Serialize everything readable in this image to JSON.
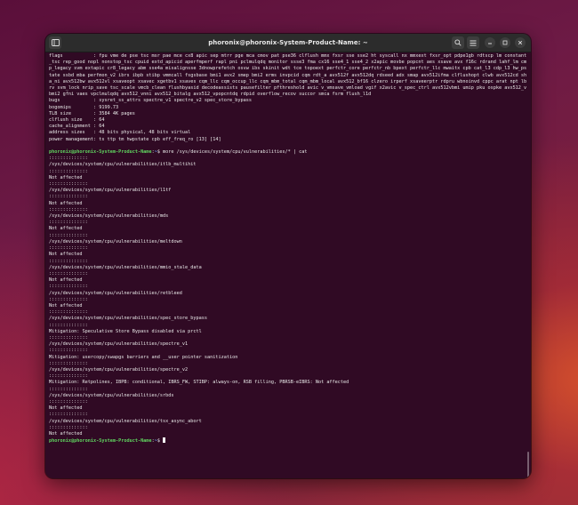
{
  "window": {
    "title": "phoronix@phoronix-System-Product-Name: ~"
  },
  "titlebar": {
    "new_tab_icon": "terminal-tab-icon",
    "search_icon": "search-icon",
    "menu_icon": "hamburger-menu-icon",
    "minimize_icon": "minimize-icon",
    "maximize_icon": "maximize-icon",
    "close_icon": "close-icon"
  },
  "terminal": {
    "lines": [
      {
        "text": "flags           : fpu vme de pse tsc msr pae mce cx8 apic sep mtrr pge mca cmov pat pse36 clflush mmx fxsr sse sse2 ht syscall nx mmxext fxsr_opt pdpe1gb rdtscp lm constant_tsc rep_good nopl nonstop_tsc cpuid extd_apicid aperfmperf rapl pni pclmulqdq monitor ssse3 fma cx16 sse4_1 sse4_2 x2apic movbe popcnt aes xsave avx f16c rdrand lahf_lm cmp_legacy svm extapic cr8_legacy abm sse4a misalignsse 3dnowprefetch osvw ibs skinit wdt tce topoext perfctr_core perfctr_nb bpext perfctr_llc mwaitx cpb cat_l3 cdp_l3 hw_pstate ssbd mba perfmon_v2 ibrs ibpb stibp vmmcall fsgsbase bmi1 avx2 smep bmi2 erms invpcid cqm rdt_a avx512f avx512dq rdseed adx smap avx512ifma clflushopt clwb avx512cd sha_ni avx512bw avx512vl xsaveopt xsavec xgetbv1 xsaves cqm_llc cqm_occup_llc cqm_mbm_total cqm_mbm_local avx512_bf16 clzero irperf xsaveerptr rdpru wbnoinvd cppc arat npt lbrv svm_lock nrip_save tsc_scale vmcb_clean flushbyasid decodeassists pausefilter pfthreshold avic v_vmsave_vmload vgif x2avic v_spec_ctrl avx512vbmi umip pku ospke avx512_vbmi2 gfni vaes vpclmulqdq avx512_vnni avx512_bitalg avx512_vpopcntdq rdpid overflow_recov succor smca fsrm flush_l1d"
      },
      {
        "text": "bugs            : sysret_ss_attrs spectre_v1 spectre_v2 spec_store_bypass"
      },
      {
        "text": "bogomips        : 9199.73"
      },
      {
        "text": "TLB size        : 3584 4K pages"
      },
      {
        "text": "clflush size    : 64"
      },
      {
        "text": "cache_alignment : 64"
      },
      {
        "text": "address sizes   : 48 bits physical, 48 bits virtual"
      },
      {
        "text": "power management: ts ttp tm hwpstate cpb eff_freq_ro [13] [14]"
      },
      {
        "text": ""
      },
      {
        "prompt": true,
        "user": "phoronix@phoronix-System-Product-Name",
        "path": "~",
        "cmd": "$ more /sys/devices/system/cpu/vulnerabilities/* | cat"
      },
      {
        "text": "::::::::::::::"
      },
      {
        "text": "/sys/devices/system/cpu/vulnerabilities/itlb_multihit"
      },
      {
        "text": "::::::::::::::"
      },
      {
        "text": "Not affected"
      },
      {
        "text": "::::::::::::::"
      },
      {
        "text": "/sys/devices/system/cpu/vulnerabilities/l1tf"
      },
      {
        "text": "::::::::::::::"
      },
      {
        "text": "Not affected"
      },
      {
        "text": "::::::::::::::"
      },
      {
        "text": "/sys/devices/system/cpu/vulnerabilities/mds"
      },
      {
        "text": "::::::::::::::"
      },
      {
        "text": "Not affected"
      },
      {
        "text": "::::::::::::::"
      },
      {
        "text": "/sys/devices/system/cpu/vulnerabilities/meltdown"
      },
      {
        "text": "::::::::::::::"
      },
      {
        "text": "Not affected"
      },
      {
        "text": "::::::::::::::"
      },
      {
        "text": "/sys/devices/system/cpu/vulnerabilities/mmio_stale_data"
      },
      {
        "text": "::::::::::::::"
      },
      {
        "text": "Not affected"
      },
      {
        "text": "::::::::::::::"
      },
      {
        "text": "/sys/devices/system/cpu/vulnerabilities/retbleed"
      },
      {
        "text": "::::::::::::::"
      },
      {
        "text": "Not affected"
      },
      {
        "text": "::::::::::::::"
      },
      {
        "text": "/sys/devices/system/cpu/vulnerabilities/spec_store_bypass"
      },
      {
        "text": "::::::::::::::"
      },
      {
        "text": "Mitigation: Speculative Store Bypass disabled via prctl"
      },
      {
        "text": "::::::::::::::"
      },
      {
        "text": "/sys/devices/system/cpu/vulnerabilities/spectre_v1"
      },
      {
        "text": "::::::::::::::"
      },
      {
        "text": "Mitigation: usercopy/swapgs barriers and __user pointer sanitization"
      },
      {
        "text": "::::::::::::::"
      },
      {
        "text": "/sys/devices/system/cpu/vulnerabilities/spectre_v2"
      },
      {
        "text": "::::::::::::::"
      },
      {
        "text": "Mitigation: Retpolines, IBPB: conditional, IBRS_FW, STIBP: always-on, RSB filling, PBRSB-eIBRS: Not affected"
      },
      {
        "text": "::::::::::::::"
      },
      {
        "text": "/sys/devices/system/cpu/vulnerabilities/srbds"
      },
      {
        "text": "::::::::::::::"
      },
      {
        "text": "Not affected"
      },
      {
        "text": "::::::::::::::"
      },
      {
        "text": "/sys/devices/system/cpu/vulnerabilities/tsx_async_abort"
      },
      {
        "text": "::::::::::::::"
      },
      {
        "text": "Not affected"
      },
      {
        "prompt": true,
        "user": "phoronix@phoronix-System-Product-Name",
        "path": "~",
        "cmd": "$ ",
        "cursor": true
      }
    ]
  },
  "colors": {
    "terminal_bg": "#300a24",
    "prompt_user": "#5fd35f",
    "prompt_path": "#6aa6ff",
    "titlebar_bg": "#2c2c2c"
  }
}
